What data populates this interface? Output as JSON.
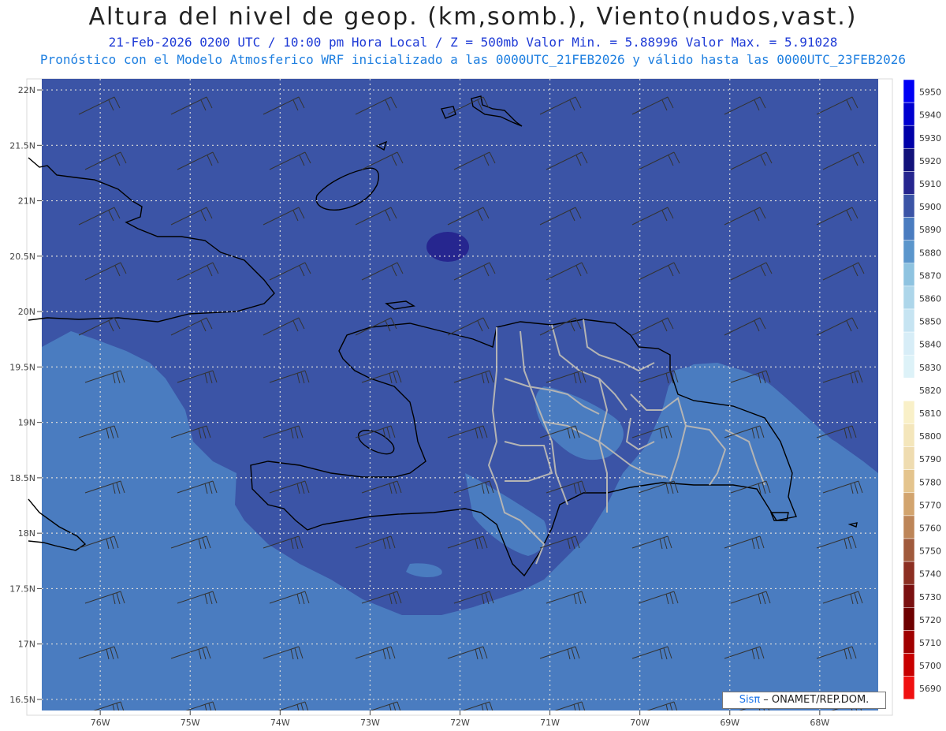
{
  "title": "Altura del nivel de geop. (km,somb.), Viento(nudos,vast.)",
  "subtitle_line1": "21-Feb-2026  0200 UTC / 10:00 pm Hora Local / Z = 500mb    Valor Min. = 5.88996  Valor Max. = 5.91028",
  "subtitle_line2": "Pronóstico con el Modelo Atmosferico WRF inicializado a las 0000UTC_21FEB2026 y válido hasta las  0000UTC_23FEB2026",
  "credit": {
    "brand": "Sisπ",
    "text": " – ONAMET/REP.DOM."
  },
  "chart_data": {
    "type": "heatmap",
    "field": "500mb geopotential height",
    "min_value": 5.88996,
    "max_value": 5.91028,
    "lat_ticks": [
      "22N",
      "21.5N",
      "21N",
      "20.5N",
      "20N",
      "19.5N",
      "19N",
      "18.5N",
      "18N",
      "17.5N",
      "17N",
      "16.5N"
    ],
    "lon_ticks": [
      "76W",
      "75W",
      "74W",
      "73W",
      "72W",
      "71W",
      "70W",
      "69W",
      "68W"
    ],
    "lat_range": [
      16.4,
      22.1
    ],
    "lon_range": [
      -76.65,
      -67.35
    ],
    "grid": true,
    "colorbar": {
      "levels": [
        5950,
        5940,
        5930,
        5920,
        5910,
        5900,
        5890,
        5880,
        5870,
        5860,
        5850,
        5840,
        5830,
        5820,
        5810,
        5800,
        5790,
        5780,
        5770,
        5760,
        5750,
        5740,
        5730,
        5720,
        5710,
        5700,
        5690
      ],
      "colors": [
        "#0000f5",
        "#0000d0",
        "#0000a8",
        "#12127a",
        "#26268f",
        "#3b54a6",
        "#4a7cc0",
        "#5b96cc",
        "#8ec3e0",
        "#add6ea",
        "#c6e4f2",
        "#d7edf7",
        "#ddf2f8",
        "#ffffff",
        "#f9f0c8",
        "#f4e6bb",
        "#efdcb0",
        "#e4c48d",
        "#d2a46e",
        "#bd8558",
        "#a05a3c",
        "#8c2f22",
        "#7a1010",
        "#6e0000",
        "#a00000",
        "#c80000",
        "#f01010"
      ]
    },
    "wind": {
      "representation": "barbs",
      "units": "nudos"
    }
  },
  "colors": {
    "height_5900_5910": "#3b54a6",
    "height_5890_5900": "#4a7cc0",
    "height_5910_5920": "#26268f",
    "coastline": "#000000",
    "province_borders": "#b4b4b4",
    "grid": "#d9d9d9"
  }
}
